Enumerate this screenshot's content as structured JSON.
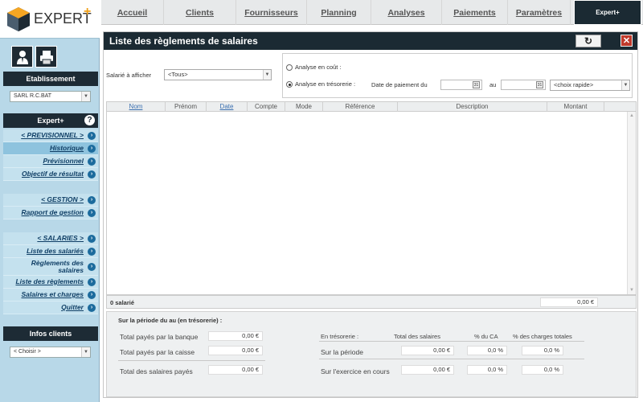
{
  "brand": {
    "name": "EXPERT",
    "plus": "+"
  },
  "sidebar": {
    "etablissement_title": "Etablissement",
    "etablissement_value": "SARL R.C.BAT",
    "expert_title": "Expert+",
    "help_icon": "question-icon",
    "menu": [
      {
        "label": "< PREVISIONNEL >",
        "active": false
      },
      {
        "label": "Historique",
        "active": true
      },
      {
        "label": "Prévisionnel",
        "active": false
      },
      {
        "label": "Objectif de résultat",
        "active": false
      },
      {
        "label": "< GESTION >",
        "active": false
      },
      {
        "label": "Rapport de gestion",
        "active": false
      },
      {
        "label": "< SALARIES >",
        "active": false
      },
      {
        "label": "Liste des salariés",
        "active": false
      },
      {
        "label": "Règlements des salaires",
        "active": false
      },
      {
        "label": "Liste des règlements",
        "active": false
      },
      {
        "label": "Salaires et charges",
        "active": false
      },
      {
        "label": "Quitter",
        "active": false
      }
    ],
    "infos_title": "Infos clients",
    "infos_value": "< Choisir >"
  },
  "nav": {
    "tabs": [
      "Accueil",
      "Clients",
      "Fournisseurs",
      "Planning",
      "Analyses",
      "Paiements",
      "Paramètres",
      "Expert+"
    ],
    "active": "Expert+"
  },
  "panel": {
    "title": "Liste des règlements de salaires",
    "refresh_icon": "refresh-icon",
    "close_icon": "close-icon"
  },
  "filters": {
    "salarie_label": "Salarié à afficher",
    "salarie_value": "<Tous>",
    "radio_cout": "Analyse en coût :",
    "radio_tresorerie": "Analyse en trésorerie :",
    "selected": "tresorerie",
    "date_label": "Date de paiement du",
    "date_from": "",
    "au_label": "au",
    "date_to": "",
    "rapide_value": "<choix rapide>"
  },
  "table": {
    "columns": [
      "Nom",
      "Prénom",
      "Date",
      "Compte",
      "Mode",
      "Référence",
      "Description",
      "Montant"
    ],
    "rows": []
  },
  "totals": {
    "count": "0 salarié",
    "amount": "0,00 €"
  },
  "summary": {
    "title": "Sur la période du au (en trésorerie) :",
    "banque_label": "Total payés par la banque",
    "banque_value": "0,00 €",
    "caisse_label": "Total payés par la caisse",
    "caisse_value": "0,00 €",
    "total_label": "Total des salaires payés",
    "total_value": "0,00 €",
    "col_tresorerie": "En trésorerie :",
    "col_total": "Total des salaires",
    "col_ca": "% du CA",
    "col_charges": "% des charges totales",
    "periode_label": "Sur la période",
    "periode_total": "0,00 €",
    "periode_ca": "0,0 %",
    "periode_charges": "0,0 %",
    "exercice_label": "Sur l'exercice en cours",
    "exercice_total": "0,00 €",
    "exercice_ca": "0,0 %",
    "exercice_charges": "0,0 %"
  }
}
